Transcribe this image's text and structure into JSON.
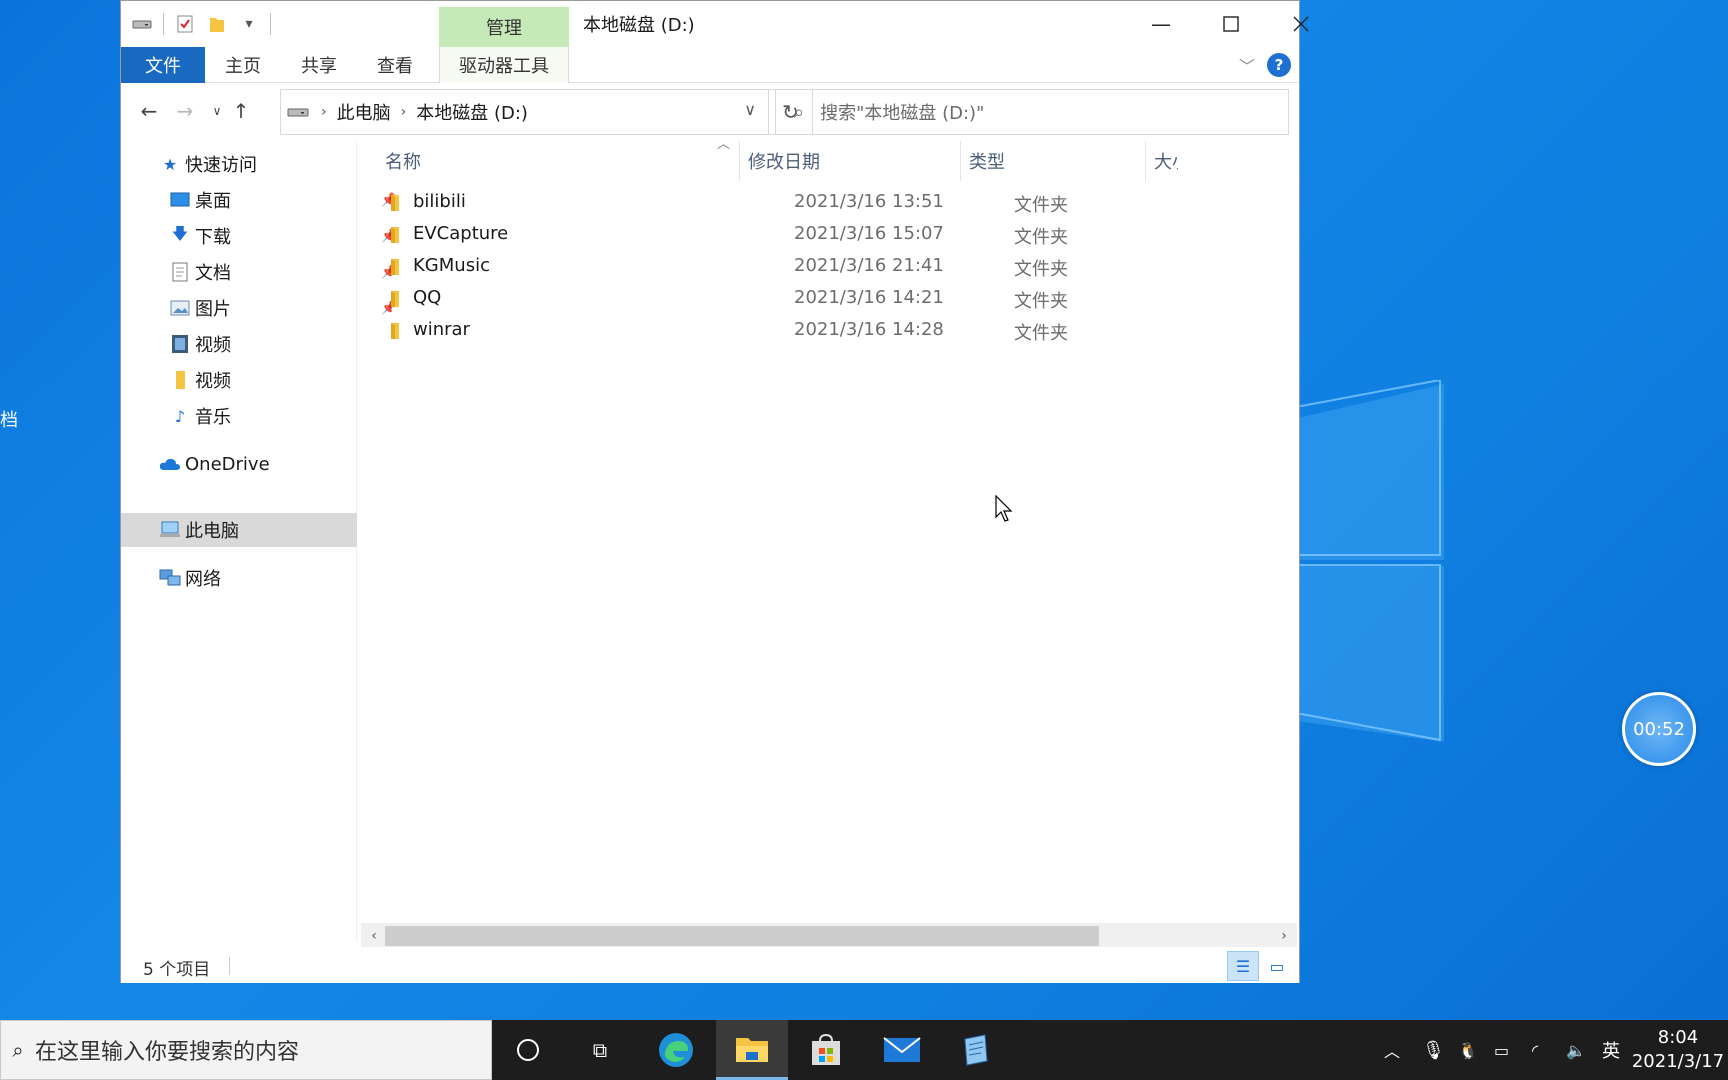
{
  "window": {
    "title": "本地磁盘 (D:)",
    "manage_tab": "管理",
    "minimize_icon": "minimize-icon",
    "maximize_icon": "maximize-icon",
    "close_icon": "close-icon"
  },
  "ribbon": {
    "tabs": [
      "文件",
      "主页",
      "共享",
      "查看",
      "驱动器工具"
    ],
    "help_label": "?"
  },
  "nav": {
    "breadcrumb": [
      "此电脑",
      "本地磁盘 (D:)"
    ],
    "search_placeholder": "搜索\"本地磁盘 (D:)\""
  },
  "navpane": {
    "quick_access": "快速访问",
    "items": [
      {
        "label": "桌面",
        "icon": "desktop-icon",
        "pinned": true
      },
      {
        "label": "下载",
        "icon": "download-icon",
        "pinned": true
      },
      {
        "label": "文档",
        "icon": "document-icon",
        "pinned": true
      },
      {
        "label": "图片",
        "icon": "picture-icon",
        "pinned": true
      },
      {
        "label": "视频",
        "icon": "video-icon",
        "pinned": false
      },
      {
        "label": "视频",
        "icon": "folder-icon",
        "pinned": false
      },
      {
        "label": "音乐",
        "icon": "music-icon",
        "pinned": false
      }
    ],
    "onedrive": "OneDrive",
    "this_pc": "此电脑",
    "network": "网络"
  },
  "columns": [
    "名称",
    "修改日期",
    "类型",
    "大小"
  ],
  "files": [
    {
      "name": "bilibili",
      "date": "2021/3/16 13:51",
      "type": "文件夹"
    },
    {
      "name": "EVCapture",
      "date": "2021/3/16 15:07",
      "type": "文件夹"
    },
    {
      "name": "KGMusic",
      "date": "2021/3/16 21:41",
      "type": "文件夹"
    },
    {
      "name": "QQ",
      "date": "2021/3/16 14:21",
      "type": "文件夹"
    },
    {
      "name": "winrar",
      "date": "2021/3/16 14:28",
      "type": "文件夹"
    }
  ],
  "status": {
    "item_count": "5 个项目"
  },
  "desktop": {
    "partial_label": "档",
    "timer": "00:52"
  },
  "taskbar": {
    "search_placeholder": "在这里输入你要搜索的内容",
    "ime": "英",
    "time": "8:04",
    "date": "2021/3/17"
  },
  "colors": {
    "file_tab": "#1969c1",
    "manage_tab": "#c6e9b8",
    "folder": "#f5c542",
    "selected_nav": "#d9d9d9"
  }
}
